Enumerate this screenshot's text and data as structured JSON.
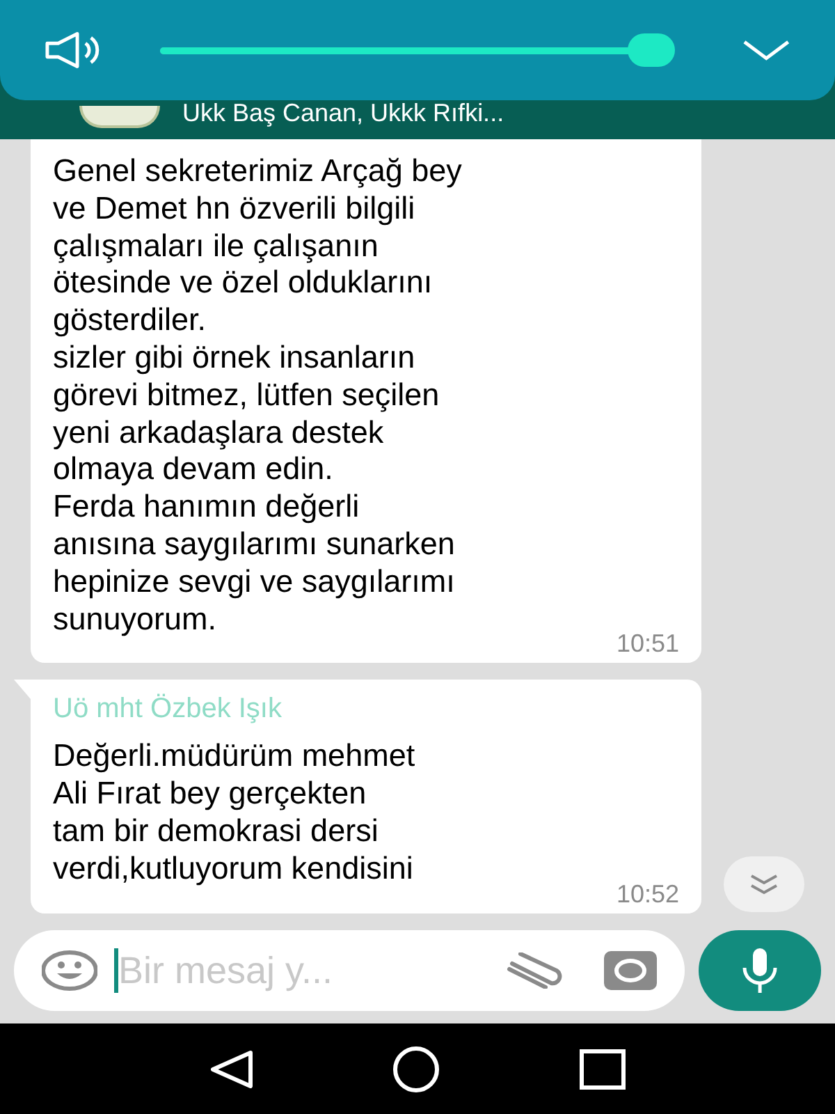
{
  "volume_panel": {
    "level": 0.96
  },
  "chat_header": {
    "subtitle": "Ukk Baş Canan, Ukkk Rıfki..."
  },
  "messages": [
    {
      "text": "Genel sekreterimiz Arçağ  bey\nve Demet  hn özverili bilgili\nçalışmaları ile  çalışanın\nötesinde ve özel olduklarını\ngösterdiler.\n sizler gibi örnek insanların\ngörevi bitmez, lütfen seçilen\nyeni arkadaşlara destek\nolmaya devam edin.\nFerda hanımın değerli\nanısına saygılarımı sunarken\nhepinize sevgi ve saygılarımı\nsunuyorum.",
      "time": "10:51"
    },
    {
      "sender": "Uö mht Özbek Işık",
      "text": "Değerli.müdürüm mehmet\nAli Fırat bey gerçekten\ntam bir demokrasi dersi\nverdi,kutluyorum kendisini",
      "time": "10:52"
    }
  ],
  "composer": {
    "placeholder": "Bir mesaj y..."
  }
}
